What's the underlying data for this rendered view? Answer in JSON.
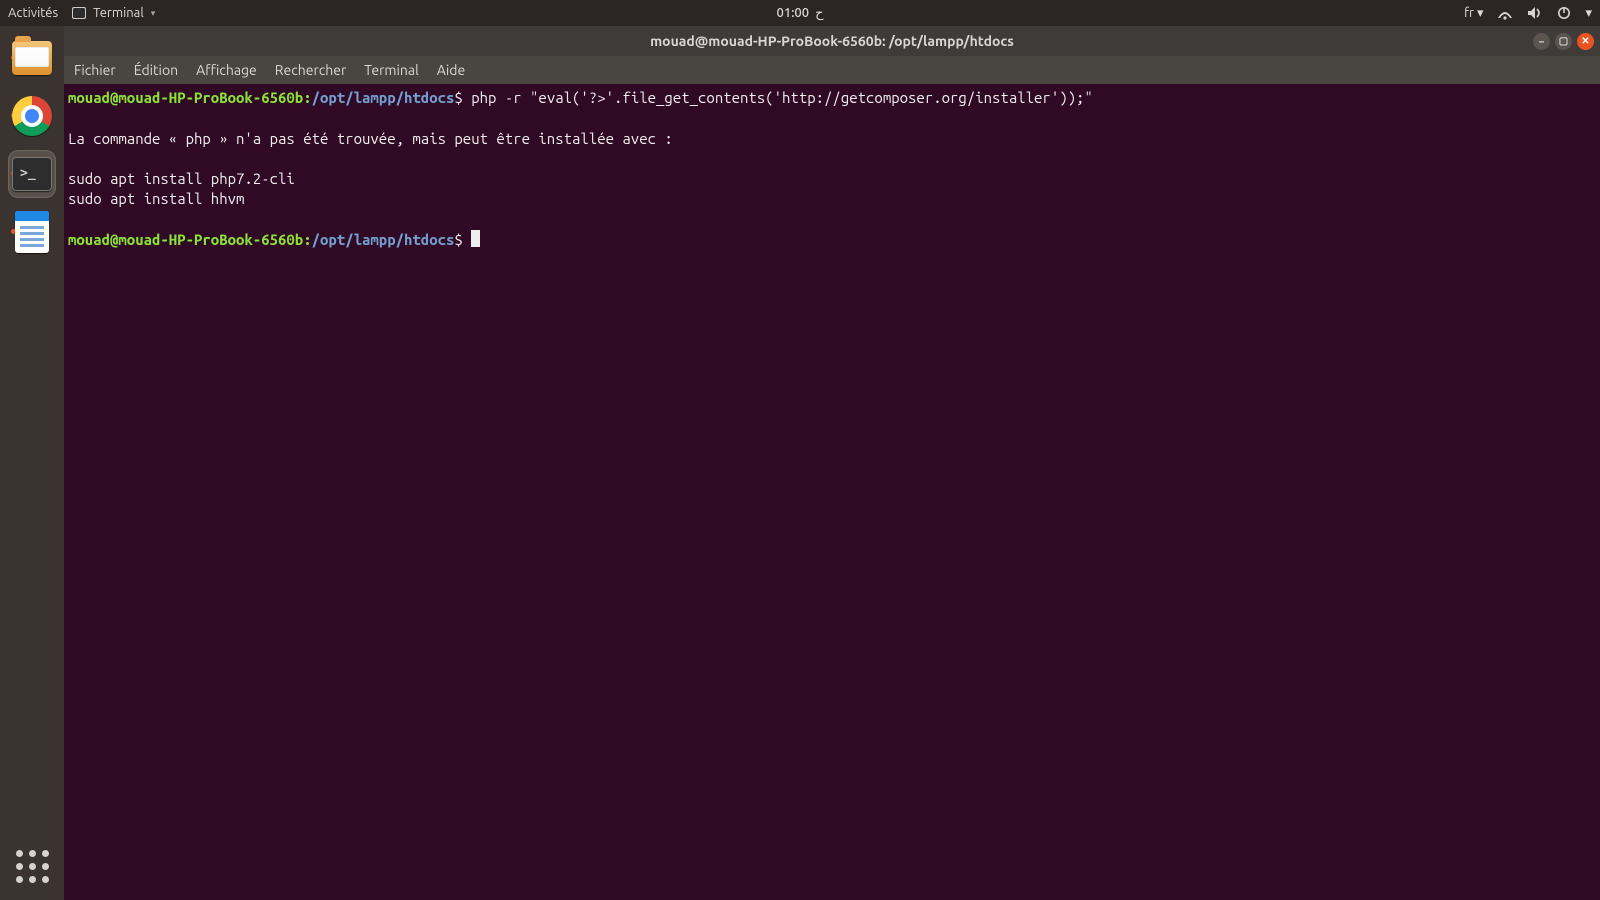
{
  "topbar": {
    "activities": "Activités",
    "app_name": "Terminal",
    "clock": "01:00",
    "clock_extra": "ح",
    "input_lang": "fr"
  },
  "dock": {
    "items": [
      {
        "name": "files"
      },
      {
        "name": "chrome"
      },
      {
        "name": "terminal"
      },
      {
        "name": "writer"
      }
    ]
  },
  "window": {
    "title": "mouad@mouad-HP-ProBook-6560b: /opt/lampp/htdocs",
    "menus": [
      "Fichier",
      "Édition",
      "Affichage",
      "Rechercher",
      "Terminal",
      "Aide"
    ]
  },
  "prompt": {
    "userhost": "mouad@mouad-HP-ProBook-6560b",
    "sep": ":",
    "path": "/opt/lampp/htdocs",
    "dollar": "$"
  },
  "terminal": {
    "cmd1": " php -r \"eval('?>'.file_get_contents('http://getcomposer.org/installer'));\"",
    "blank": "",
    "out1": "La commande « php » n'a pas été trouvée, mais peut être installée avec :",
    "out2": "sudo apt install php7.2-cli",
    "out3": "sudo apt install hhvm"
  }
}
